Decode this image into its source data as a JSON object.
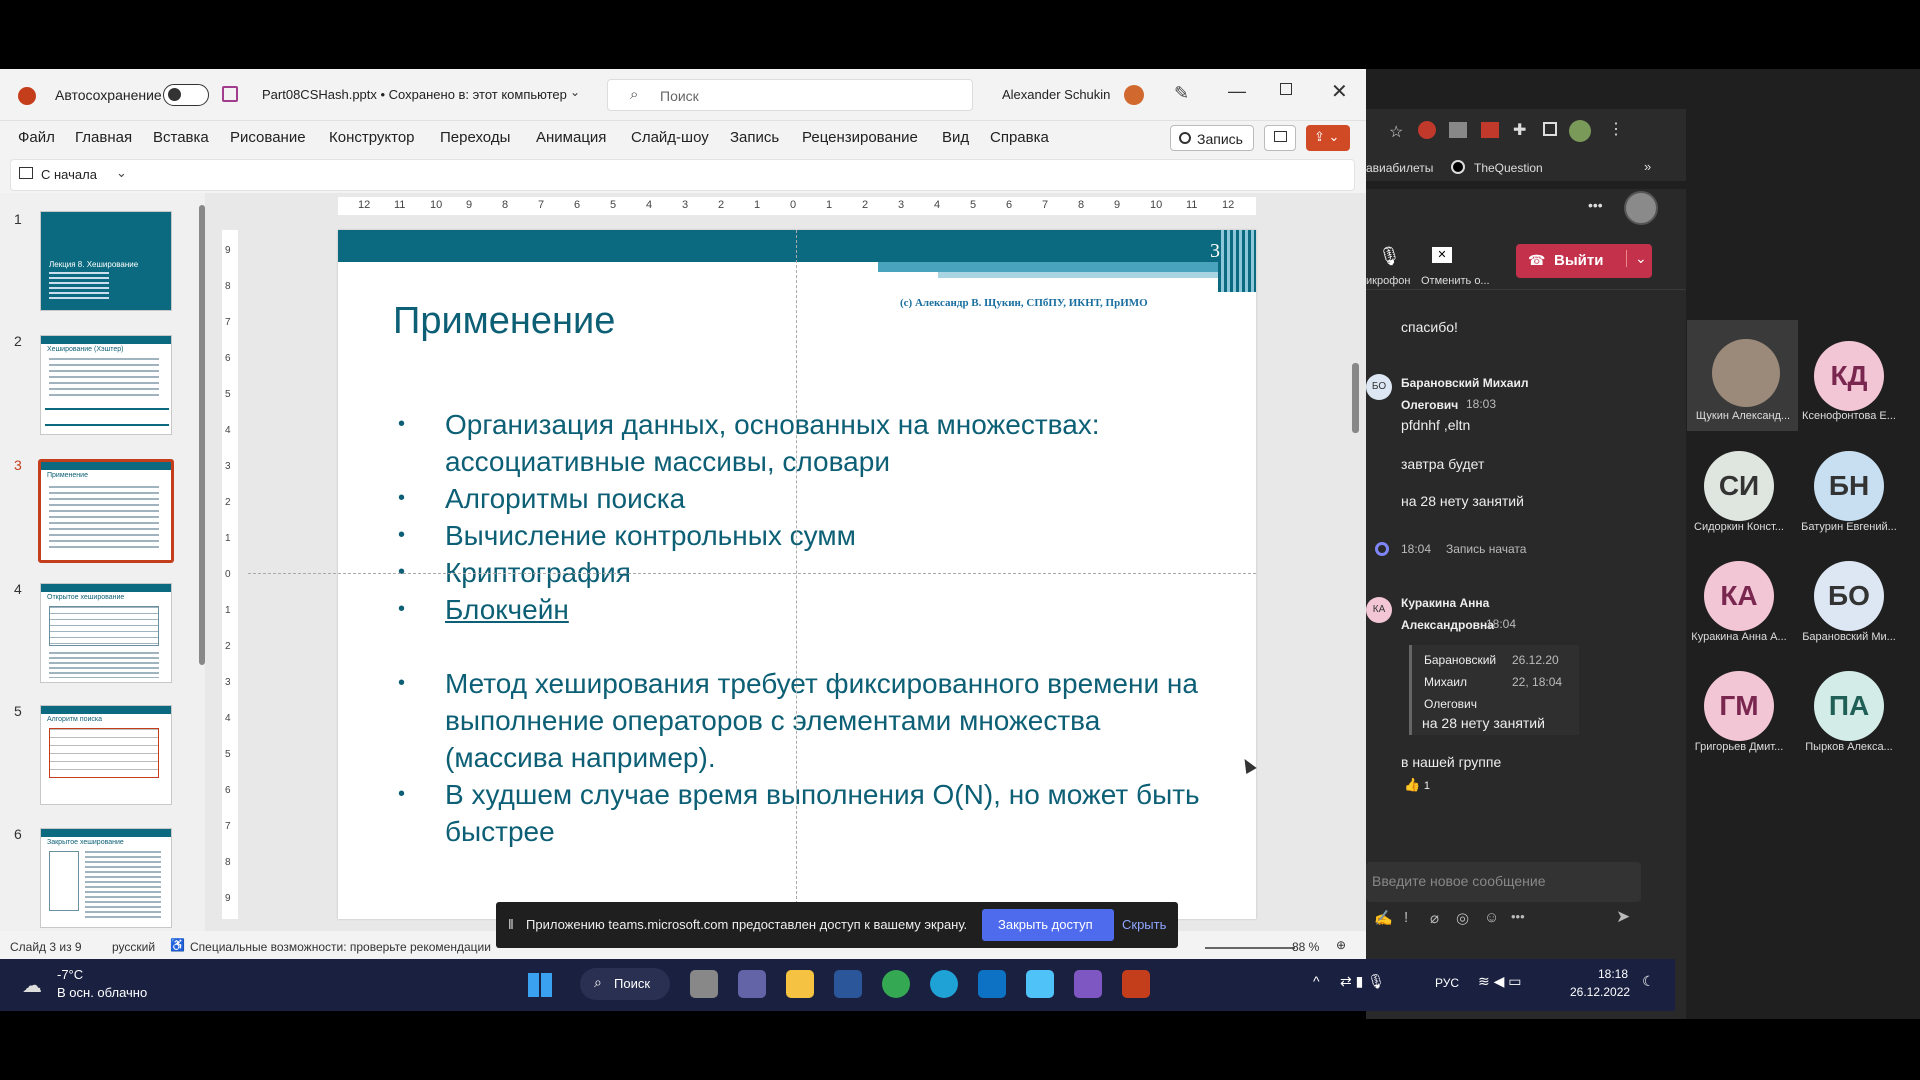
{
  "ppt": {
    "autosave_label": "Автосохранение",
    "file_title": "Part08CSHash.pptx • Сохранено в: этот компьютер",
    "search_placeholder": "Поиск",
    "user_name": "Alexander Schukin",
    "menu": [
      "Файл",
      "Главная",
      "Вставка",
      "Рисование",
      "Конструктор",
      "Переходы",
      "Анимация",
      "Слайд-шоу",
      "Запись",
      "Рецензирование",
      "Вид",
      "Справка"
    ],
    "record_button": "Запись",
    "from_start": "С начала",
    "thumbnails": [
      {
        "num": "1",
        "title": "Лекция 8. Хеширование"
      },
      {
        "num": "2",
        "title": "Хеширование (Хэштер)"
      },
      {
        "num": "3",
        "title": "Применение"
      },
      {
        "num": "4",
        "title": "Открытое хеширование"
      },
      {
        "num": "5",
        "title": "Алгоритм поиска"
      },
      {
        "num": "6",
        "title": "Закрытое хеширование"
      }
    ],
    "ruler_top": [
      "12",
      "11",
      "10",
      "9",
      "8",
      "7",
      "6",
      "5",
      "4",
      "3",
      "2",
      "1",
      "0",
      "1",
      "2",
      "3",
      "4",
      "5",
      "6",
      "7",
      "8",
      "9",
      "10",
      "11",
      "12"
    ],
    "ruler_left": [
      "9",
      "8",
      "7",
      "6",
      "5",
      "4",
      "3",
      "2",
      "1",
      "0",
      "1",
      "2",
      "3",
      "4",
      "5",
      "6",
      "7",
      "8",
      "9"
    ],
    "slide": {
      "page_number": "3",
      "copyright": "(c) Александр В. Щукин, СПбПУ, ИКНТ, ПрИМО",
      "title": "Применение",
      "bullets": [
        "Организация данных, основанных на множествах: ассоциативные массивы, словари",
        "Алгоритмы поиска",
        "Вычисление контрольных сумм",
        "Криптография",
        "Блокчейн",
        "Метод хеширования требует фиксированного времени на выполнение операторов с элементами множества (массива например).",
        "В худшем случае время выполнения O(N), но может быть быстрее"
      ]
    },
    "status": {
      "slide_of": "Слайд 3 из 9",
      "language": "русский",
      "accessibility": "Специальные возможности: проверьте рекомендации",
      "zoom": "88 %"
    },
    "share_bar": {
      "message": "Приложению teams.microsoft.com предоставлен доступ к вашему экрану.",
      "stop_button": "Закрыть доступ",
      "hide_button": "Скрыть"
    }
  },
  "browser": {
    "bookmarks": [
      "авиабилеты",
      "TheQuestion"
    ]
  },
  "teams": {
    "mic_label": "икрофон",
    "cancel_label": "Отменить о...",
    "leave_button": "Выйти",
    "messages": [
      {
        "type": "text",
        "text": "спасибо!"
      },
      {
        "type": "header",
        "initials": "БО",
        "author": "Барановский Михаил Олегович",
        "time": "18:03"
      },
      {
        "type": "text",
        "text": "pfdnhf ,eltn"
      },
      {
        "type": "text",
        "text": "завтра будет"
      },
      {
        "type": "text",
        "text": "на 28 нету занятий"
      },
      {
        "type": "event",
        "time": "18:04",
        "text": "Запись начата"
      },
      {
        "type": "header",
        "initials": "КА",
        "author": "Куракина Анна Александровна",
        "time": "18:04"
      },
      {
        "type": "quote",
        "author": "Барановский Михаил Олегович",
        "date": "26.12.20 22, 18:04",
        "text": "на 28 нету занятий"
      },
      {
        "type": "text",
        "text": "в нашей группе"
      },
      {
        "type": "reaction",
        "emoji": "👍",
        "count": "1"
      }
    ],
    "input_placeholder": "Введите новое сообщение",
    "participants": [
      {
        "initials": "",
        "name": "Щукин Александ...",
        "color": "#3a3a3a"
      },
      {
        "initials": "КД",
        "name": "Ксенофонтова Е...",
        "color": "#f3c6d6"
      },
      {
        "initials": "СИ",
        "name": "Сидоркин Конст...",
        "color": "#dfe6df"
      },
      {
        "initials": "БН",
        "name": "Батурин Евгений...",
        "color": "#c7dff0"
      },
      {
        "initials": "КА",
        "name": "Куракина Анна А...",
        "color": "#f3c6d6"
      },
      {
        "initials": "БО",
        "name": "Барановский Ми...",
        "color": "#dde7f3"
      },
      {
        "initials": "ГМ",
        "name": "Григорьев Дмит...",
        "color": "#f3c6d6"
      },
      {
        "initials": "ПА",
        "name": "Пырков Алекса...",
        "color": "#d3ece7"
      }
    ]
  },
  "taskbar": {
    "weather_temp": "-7°C",
    "weather_desc": "В осн. облачно",
    "search_label": "Поиск",
    "lang": "РУС",
    "time": "18:18",
    "date": "26.12.2022"
  }
}
